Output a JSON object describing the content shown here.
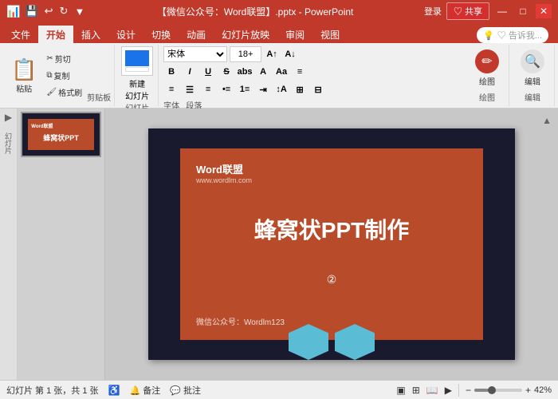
{
  "titlebar": {
    "title": "【微信公众号：Word联盟】.pptx - PowerPoint",
    "save_icon": "💾",
    "undo_icon": "↩",
    "redo_icon": "↻",
    "customize_icon": "▼"
  },
  "tabs": [
    {
      "label": "文件",
      "active": false
    },
    {
      "label": "开始",
      "active": true
    },
    {
      "label": "插入",
      "active": false
    },
    {
      "label": "设计",
      "active": false
    },
    {
      "label": "切换",
      "active": false
    },
    {
      "label": "动画",
      "active": false
    },
    {
      "label": "幻灯片放映",
      "active": false
    },
    {
      "label": "审阅",
      "active": false
    },
    {
      "label": "视图",
      "active": false
    }
  ],
  "ribbon": {
    "clipboard": {
      "label": "剪贴板",
      "paste_label": "粘贴",
      "cut_label": "剪切",
      "copy_label": "复制",
      "format_label": "格式刷"
    },
    "slides": {
      "label": "幻灯片",
      "new_label": "新建\n幻灯片"
    },
    "font": {
      "label": "字体",
      "font_name": "宋体",
      "font_size": "18+"
    },
    "paragraph": {
      "label": "段落"
    },
    "drawing": {
      "label": "绘图",
      "btn_label": "绘图"
    },
    "editing": {
      "label": "编辑",
      "btn_label": "编辑"
    }
  },
  "tell_me": {
    "placeholder": "♡ 告诉我..."
  },
  "login": {
    "label": "登录"
  },
  "share": {
    "label": "♡ 共享"
  },
  "slide": {
    "logo": "Word联盟",
    "logo_url": "www.wordlm.com",
    "title": "蜂窝状PPT制作",
    "subtitle": "②",
    "footer": "微信公众号：Wordlm123"
  },
  "statusbar": {
    "slide_info": "幻灯片 第 1 张，共 1 张",
    "notes_label": "备注",
    "comments_label": "批注",
    "zoom_percent": "42%"
  }
}
